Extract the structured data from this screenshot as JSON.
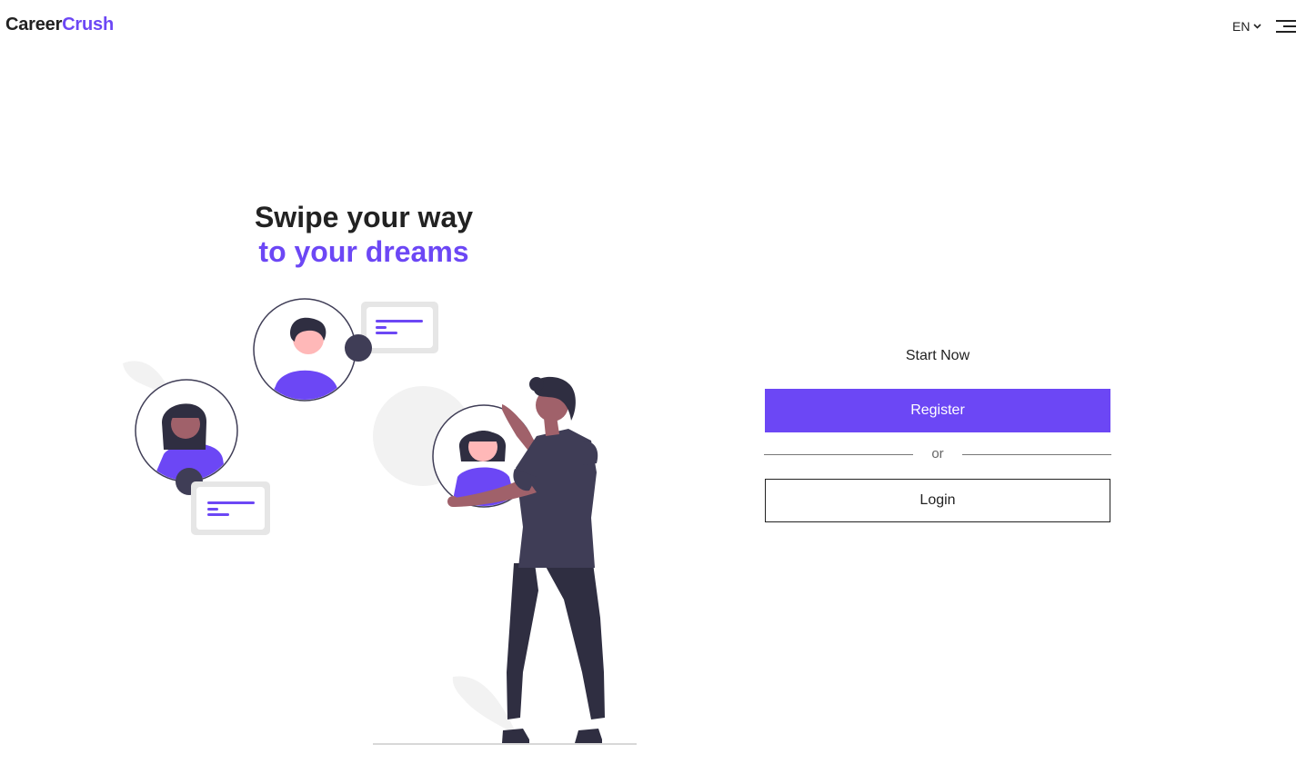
{
  "header": {
    "logo_part1": "Career",
    "logo_part2": "Crush",
    "language": "EN",
    "language_icon": "chevron-down-icon",
    "menu_icon": "hamburger-menu-icon"
  },
  "hero": {
    "line1": "Swipe your way",
    "line2": "to your dreams"
  },
  "auth": {
    "start_label": "Start Now",
    "register_label": "Register",
    "divider_label": "or",
    "login_label": "Login"
  },
  "colors": {
    "accent": "#6c47f5",
    "text": "#222222",
    "illustration_dark": "#3f3d56",
    "illustration_skin": "#a0616a",
    "illustration_light": "#f2f2f2"
  }
}
